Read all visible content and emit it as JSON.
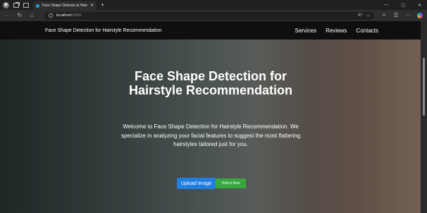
{
  "browser": {
    "tab_title": "Face Shape Detector & Hairstyle",
    "tab_close": "✕",
    "new_tab": "+",
    "url_host": "localhost:",
    "url_port": "3000",
    "window_controls": [
      "—",
      "▢",
      "✕"
    ]
  },
  "site": {
    "brand": "Face Shape Detection for Hairstyle Recommendation",
    "nav": [
      "Services",
      "Reviews",
      "Contacts"
    ]
  },
  "hero": {
    "title": "Face Shape Detection for Hairstyle Recommendation",
    "description": "Welcome to Face Shape Detection for Hairstyle Recommendation. We specialize in analyzing your facial features to suggest the most flattering hairstyles tailored just for you.",
    "upload_button": "Upload Image",
    "detect_button": "Detect Now"
  },
  "icons": {
    "back": "back-arrow-icon",
    "refresh": "refresh-icon",
    "home": "home-icon",
    "info": "info-icon",
    "read_aloud": "read-aloud-icon",
    "favorite": "star-icon",
    "extensions": "extensions-icon",
    "more": "more-icon",
    "copilot": "copilot-icon"
  },
  "colors": {
    "upload_button": "#1f7fe0",
    "detect_button": "#36a83e",
    "site_nav": "#0f0f0f"
  }
}
